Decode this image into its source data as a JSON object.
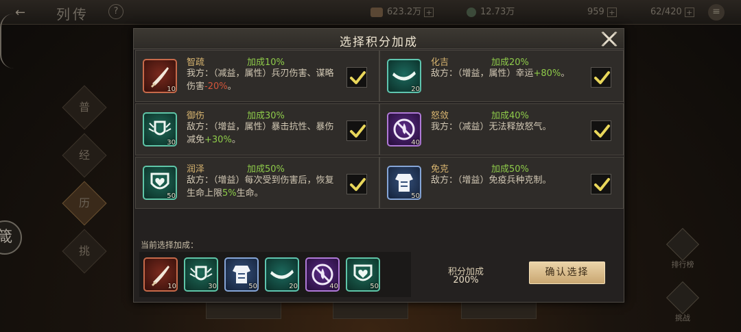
{
  "topbar": {
    "title": "列传",
    "question_icon": "?",
    "resources": [
      {
        "name": "silver",
        "value": "623.2万"
      },
      {
        "name": "gold",
        "value": "12.73万"
      },
      {
        "name": "jade",
        "value": "959"
      },
      {
        "name": "stamina",
        "value": "62/420"
      }
    ]
  },
  "left_nav": [
    "普",
    "经",
    "历",
    "挑"
  ],
  "side_circle": "箴",
  "right_buttons": [
    "排行榜",
    "挑战"
  ],
  "dialog": {
    "title": "选择积分加成",
    "cards": [
      {
        "name": "智疏",
        "bonus": "加成10%",
        "desc_pre": "我方：（减益，属性）兵刃伤害、谋略伤害",
        "desc_hl": "-20%",
        "desc_post": "。",
        "level": "10",
        "icon": "blade-icon",
        "checked": true
      },
      {
        "name": "化吉",
        "bonus": "加成20%",
        "desc_pre": "敌方：（增益，属性）幸运",
        "desc_hl": "+80%",
        "desc_post": "。",
        "level": "20",
        "icon": "horn-icon",
        "checked": true
      },
      {
        "name": "御伤",
        "bonus": "加成30%",
        "desc_pre": "敌方：（增益，属性）暴击抗性、暴伤减免",
        "desc_hl": "+30%",
        "desc_post": "。",
        "level": "30",
        "icon": "winged-shield-icon",
        "checked": true
      },
      {
        "name": "怒敛",
        "bonus": "加成40%",
        "desc_pre": "我方：（减益）无法释放怒气。",
        "desc_hl": "",
        "desc_post": "",
        "level": "40",
        "icon": "no-fire-icon",
        "checked": true
      },
      {
        "name": "润泽",
        "bonus": "加成50%",
        "desc_pre": "敌方：（增益）每次受到伤害后，恢复生命上限",
        "desc_hl": "5%",
        "desc_post": "生命。",
        "level": "50",
        "icon": "heart-shield-icon",
        "checked": true
      },
      {
        "name": "免克",
        "bonus": "加成50%",
        "desc_pre": "敌方：（增益）免疫兵种克制。",
        "desc_hl": "",
        "desc_post": "",
        "level": "50",
        "icon": "armor-icon",
        "checked": true
      }
    ],
    "current_label": "当前选择加成：",
    "selected": [
      {
        "icon": "blade-icon",
        "level": "10"
      },
      {
        "icon": "winged-shield-icon",
        "level": "30"
      },
      {
        "icon": "armor-icon",
        "level": "50"
      },
      {
        "icon": "horn-icon",
        "level": "20"
      },
      {
        "icon": "no-fire-icon",
        "level": "40"
      },
      {
        "icon": "heart-shield-icon",
        "level": "50"
      }
    ],
    "score_label": "积分加成",
    "score_value": "200%",
    "confirm_label": "确认选择"
  },
  "colors": {
    "bonus_green": "#8fcc4a",
    "name_gold": "#d8b570",
    "negative_red": "#d4553a",
    "check_yellow": "#e8d65a"
  }
}
